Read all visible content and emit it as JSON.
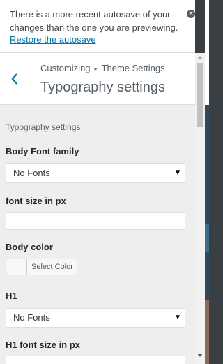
{
  "notice": {
    "message": "There is a more recent autosave of your changes than the one you are previewing.",
    "link": "Restore the autosave",
    "dismiss_icon": "dismiss-icon"
  },
  "header": {
    "back_icon": "chevron-left-icon",
    "breadcrumb": {
      "parent": "Customizing",
      "separator": "▸",
      "current": "Theme Settings"
    },
    "title": "Typography settings"
  },
  "section": {
    "title": "Typography settings",
    "fields": {
      "body_font_family": {
        "label": "Body Font family",
        "value": "No Fonts"
      },
      "font_size": {
        "label": "font size in px",
        "value": ""
      },
      "body_color": {
        "label": "Body color",
        "button": "Select Color"
      },
      "h1": {
        "label": "H1",
        "value": "No Fonts"
      },
      "h1_font_size": {
        "label": "H1 font size in px"
      }
    }
  },
  "colors": {
    "link": "#0073aa",
    "panel_bg": "#eeeeee",
    "text": "#555d66"
  }
}
